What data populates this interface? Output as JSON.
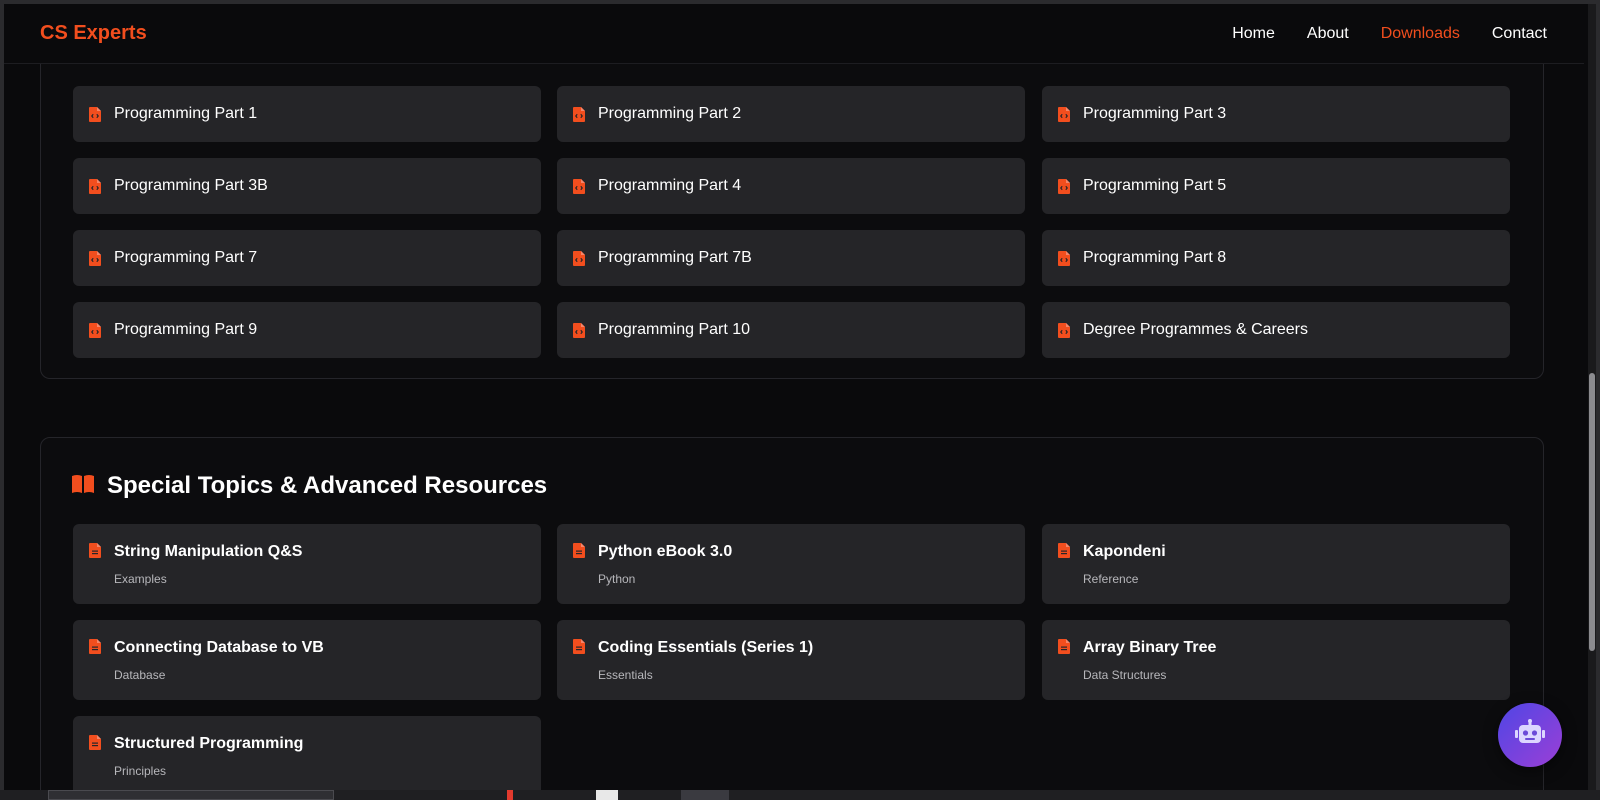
{
  "navbar": {
    "brand": "CS Experts",
    "links": [
      {
        "label": "Home"
      },
      {
        "label": "About"
      },
      {
        "label": "Downloads",
        "active": true
      },
      {
        "label": "Contact"
      }
    ]
  },
  "programming_section": {
    "cards": [
      "Programming Part 1",
      "Programming Part 2",
      "Programming Part 3",
      "Programming Part 3B",
      "Programming Part 4",
      "Programming Part 5",
      "Programming Part 7",
      "Programming Part 7B",
      "Programming Part 8",
      "Programming Part 9",
      "Programming Part 10",
      "Degree Programmes & Careers"
    ]
  },
  "special_section": {
    "title": "Special Topics & Advanced Resources",
    "cards": [
      {
        "title": "String Manipulation Q&S",
        "subtitle": "Examples"
      },
      {
        "title": "Python eBook 3.0",
        "subtitle": "Python"
      },
      {
        "title": "Kapondeni",
        "subtitle": "Reference"
      },
      {
        "title": "Connecting Database to VB",
        "subtitle": "Database"
      },
      {
        "title": "Coding Essentials (Series 1)",
        "subtitle": "Essentials"
      },
      {
        "title": "Array Binary Tree",
        "subtitle": "Data Structures"
      },
      {
        "title": "Structured Programming",
        "subtitle": "Principles"
      }
    ]
  },
  "icons": {
    "card": "file-code-icon",
    "resource": "file-icon",
    "section": "book-open-icon",
    "chatbot": "robot-icon"
  },
  "colors": {
    "accent": "#f24e1e",
    "background": "#0a0a0c",
    "card": "#252528",
    "chatbot_gradient_start": "#4f46e5",
    "chatbot_gradient_end": "#9b3fd6"
  }
}
